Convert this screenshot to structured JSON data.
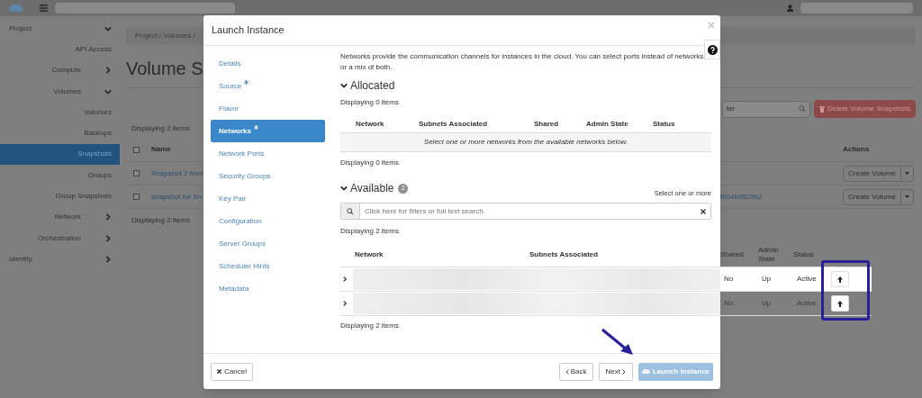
{
  "sidebar": [
    {
      "label": "Project",
      "expanded": true,
      "children": [
        {
          "label": "API Access",
          "selected": false
        },
        {
          "label": "Compute",
          "expanded": false
        },
        {
          "label": "Volumes",
          "expanded": true,
          "children": [
            {
              "label": "Volumes",
              "selected": false
            },
            {
              "label": "Backups",
              "selected": false
            },
            {
              "label": "Snapshots",
              "selected": true
            },
            {
              "label": "Groups",
              "selected": false
            },
            {
              "label": "Group Snapshots",
              "selected": false
            }
          ]
        },
        {
          "label": "Network",
          "expanded": false
        },
        {
          "label": "Orchestration",
          "expanded": false
        }
      ]
    },
    {
      "label": "Identity",
      "expanded": false
    }
  ],
  "page": {
    "breadcrumb": "Project / Volumes /",
    "title": "Volume S",
    "filter_placeholder": "ter",
    "delete_button": "Delete Volume Snapshots",
    "count_top": "Displaying 2 items",
    "select_all_checked": false,
    "columns": {
      "name": "Name",
      "actions": "Actions"
    },
    "rows": [
      {
        "checked": false,
        "name": "Snapshot 2 from",
        "action": "Create Volume"
      },
      {
        "checked": false,
        "name": "snapshot for Sn",
        "id": "fb04b952962",
        "action": "Create Volume"
      }
    ],
    "count_bottom": "Displaying 2 items"
  },
  "modal": {
    "title": "Launch Instance",
    "close": "×",
    "steps": [
      {
        "label": "Details",
        "required": false,
        "selected": false
      },
      {
        "label": "Source",
        "required": true,
        "selected": false
      },
      {
        "label": "Flavor",
        "required": false,
        "selected": false
      },
      {
        "label": "Networks",
        "required": true,
        "selected": true
      },
      {
        "label": "Network Ports",
        "required": false,
        "selected": false
      },
      {
        "label": "Security Groups",
        "required": false,
        "selected": false
      },
      {
        "label": "Key Pair",
        "required": false,
        "selected": false
      },
      {
        "label": "Configuration",
        "required": false,
        "selected": false
      },
      {
        "label": "Server Groups",
        "required": false,
        "selected": false
      },
      {
        "label": "Scheduler Hints",
        "required": false,
        "selected": false
      },
      {
        "label": "Metadata",
        "required": false,
        "selected": false
      }
    ],
    "description": "Networks provide the communication channels for instances in the cloud. You can select ports instead of networks or a mix of both.",
    "allocated": {
      "title": "Allocated",
      "expanded": true,
      "count_top": "Displaying 0 items",
      "columns": [
        "Network",
        "Subnets Associated",
        "Shared",
        "Admin State",
        "Status"
      ],
      "empty_message": "Select one or more networks from the available networks below.",
      "count_bottom": "Displaying 0 items"
    },
    "available": {
      "title": "Available",
      "expanded": true,
      "badge": "2",
      "hint": "Select one or more",
      "search_placeholder": "Click here for filters or full text search.",
      "count_top": "Displaying 2 items",
      "columns": [
        "Network",
        "Subnets Associated",
        "Shared",
        "Admin State",
        "Status"
      ],
      "rows": [
        {
          "expanded": false,
          "highlighted": true,
          "shared": "No",
          "admin_state": "Up",
          "status": "Active"
        },
        {
          "expanded": false,
          "highlighted": false,
          "shared": "No",
          "admin_state": "Up",
          "status": "Active"
        }
      ],
      "count_bottom": "Displaying 2 items"
    },
    "buttons": {
      "cancel": "Cancel",
      "back": "Back",
      "next": "Next",
      "launch": {
        "label": "Launch Instance",
        "disabled": true
      }
    }
  }
}
